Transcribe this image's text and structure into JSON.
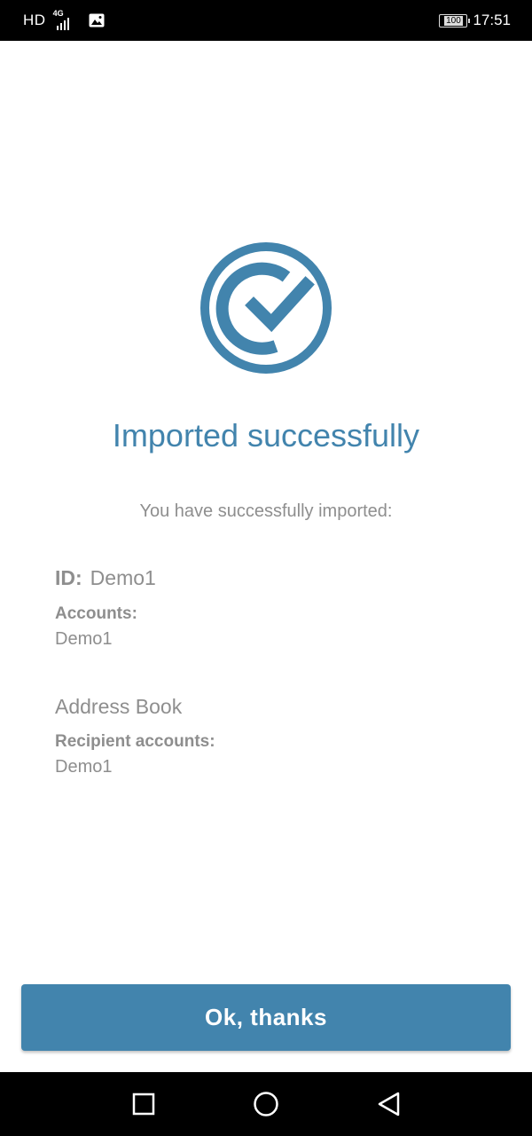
{
  "status_bar": {
    "hd": "HD",
    "network": "4G",
    "battery": "100",
    "time": "17:51"
  },
  "main": {
    "title": "Imported successfully",
    "subtitle": "You have successfully imported:",
    "id_label": "ID:",
    "id_value": "Demo1",
    "accounts_label": "Accounts:",
    "accounts_value": "Demo1",
    "address_book_title": "Address Book",
    "recipient_accounts_label": "Recipient accounts:",
    "recipient_accounts_value": "Demo1"
  },
  "button": {
    "ok_label": "Ok, thanks"
  },
  "icons": {
    "success": "check-circle-icon",
    "nav_recent": "square-icon",
    "nav_home": "circle-icon",
    "nav_back": "triangle-back-icon",
    "gallery": "image-icon"
  },
  "colors": {
    "accent": "#4284ad",
    "text_muted": "#8e8e8e",
    "status_bar_bg": "#000000"
  }
}
